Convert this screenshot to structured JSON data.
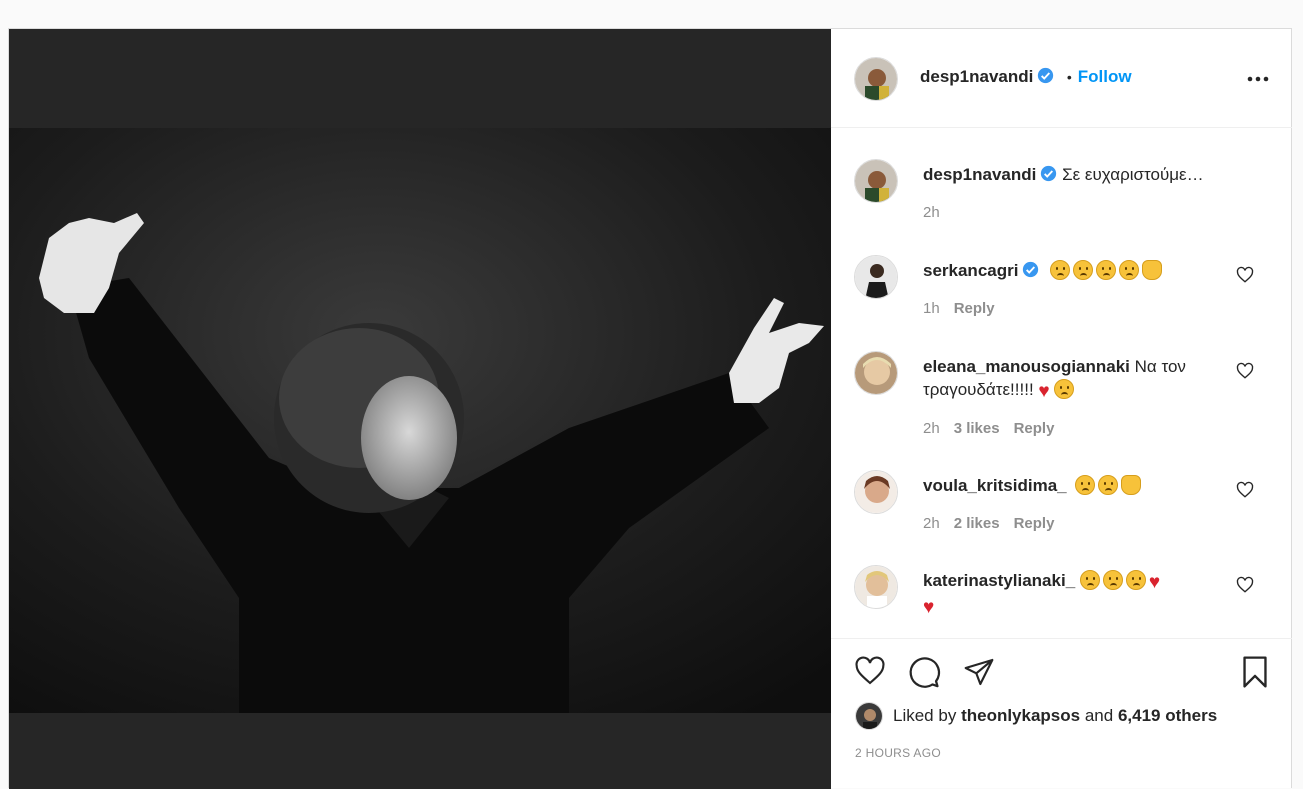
{
  "header": {
    "username": "desp1navandi",
    "separator": "•",
    "follow_label": "Follow",
    "more_icon": "more-options-icon"
  },
  "caption": {
    "username": "desp1navandi",
    "text": "Σε ευχαριστούμε…",
    "time": "2h"
  },
  "comments": [
    {
      "username": "serkancagri",
      "verified": true,
      "time": "1h",
      "likes": "",
      "reply": "Reply"
    },
    {
      "username": "eleana_manousogiannaki",
      "text": "Να τον τραγουδάτε!!!!!",
      "time": "2h",
      "likes": "3 likes",
      "reply": "Reply"
    },
    {
      "username": "voula_kritsidima_",
      "time": "2h",
      "likes": "2 likes",
      "reply": "Reply"
    },
    {
      "username": "katerinastylianaki_"
    }
  ],
  "footer": {
    "liked_prefix": "Liked by",
    "liked_user": "theonlykapsos",
    "liked_and": "and",
    "liked_others": "6,419 others",
    "timestamp": "2 HOURS AGO"
  },
  "colors": {
    "accent": "#0095f6",
    "verified": "#3897f0",
    "muted": "#8e8e8e",
    "media_bg": "#262626"
  }
}
